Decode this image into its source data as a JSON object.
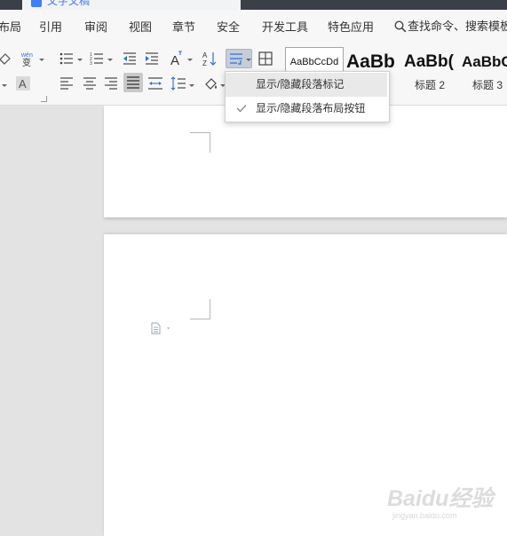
{
  "title_bar": {
    "doc_title": "文字文稿"
  },
  "menu": {
    "items": [
      {
        "label": "布局"
      },
      {
        "label": "引用"
      },
      {
        "label": "审阅"
      },
      {
        "label": "视图"
      },
      {
        "label": "章节"
      },
      {
        "label": "安全"
      },
      {
        "label": "开发工具"
      },
      {
        "label": "特色应用"
      }
    ],
    "search_label": "查找命令、搜索模板"
  },
  "ribbon": {
    "phonetic_glyph": "wén",
    "phonetic_char": "变",
    "font_color_glyph": "A",
    "char_scale_glyph": "A",
    "sort_glyph_top": "A",
    "sort_glyph_bottom": "Z",
    "styles": [
      {
        "preview": "AaBbCcDd",
        "label": ""
      },
      {
        "preview": "AaBb",
        "label": ""
      },
      {
        "preview": "AaBb(",
        "label": "标题 2"
      },
      {
        "preview": "AaBbC",
        "label": "标题 3"
      }
    ]
  },
  "dropdown": {
    "items": [
      {
        "label": "显示/隐藏段落标记",
        "checked": false
      },
      {
        "label": "显示/隐藏段落布局按钮",
        "checked": true
      }
    ]
  },
  "watermark": {
    "brand": "Baidu经验",
    "sub": "jingyan.baidu.com"
  },
  "colors": {
    "accent": "#3f7ef5",
    "titlebar": "#3b3f48",
    "ribbon_bg": "#f7f7f7",
    "doc_bg": "#e3e3e3",
    "active_button": "#c6cdd9"
  }
}
